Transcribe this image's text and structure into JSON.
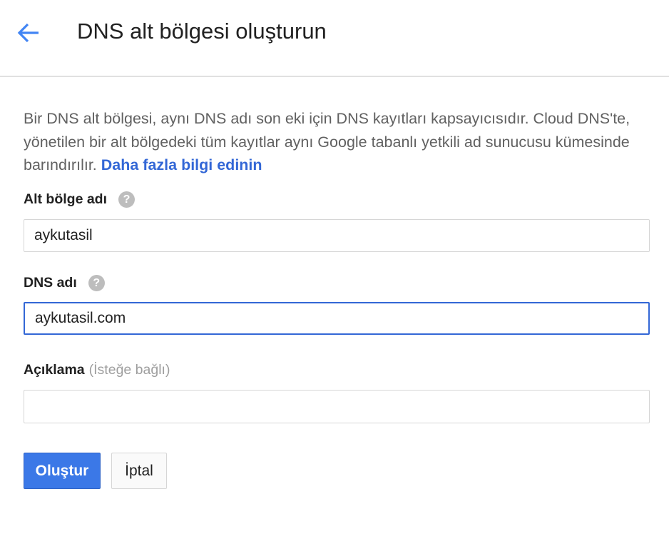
{
  "header": {
    "back_icon": "arrow-left-icon",
    "title": "DNS alt bölgesi oluşturun"
  },
  "description": {
    "text": "Bir DNS alt bölgesi, aynı DNS adı son eki için DNS kayıtları kapsayıcısıdır. Cloud DNS'te, yönetilen bir alt bölgedeki tüm kayıtlar aynı Google tabanlı yetkili ad sunucusu kümesinde barındırılır. ",
    "link_text": "Daha fazla bilgi edinin"
  },
  "form": {
    "zone_name": {
      "label": "Alt bölge adı",
      "value": "aykutasil",
      "help_icon": "question-mark-icon"
    },
    "dns_name": {
      "label": "DNS adı",
      "value": "aykutasil.com",
      "help_icon": "question-mark-icon"
    },
    "description": {
      "label": "Açıklama",
      "optional_text": "(İsteğe bağlı)",
      "value": ""
    }
  },
  "actions": {
    "create_label": "Oluştur",
    "cancel_label": "İptal"
  },
  "colors": {
    "accent": "#3b78e7",
    "link": "#3367d6",
    "focus_border": "#3367d6"
  }
}
